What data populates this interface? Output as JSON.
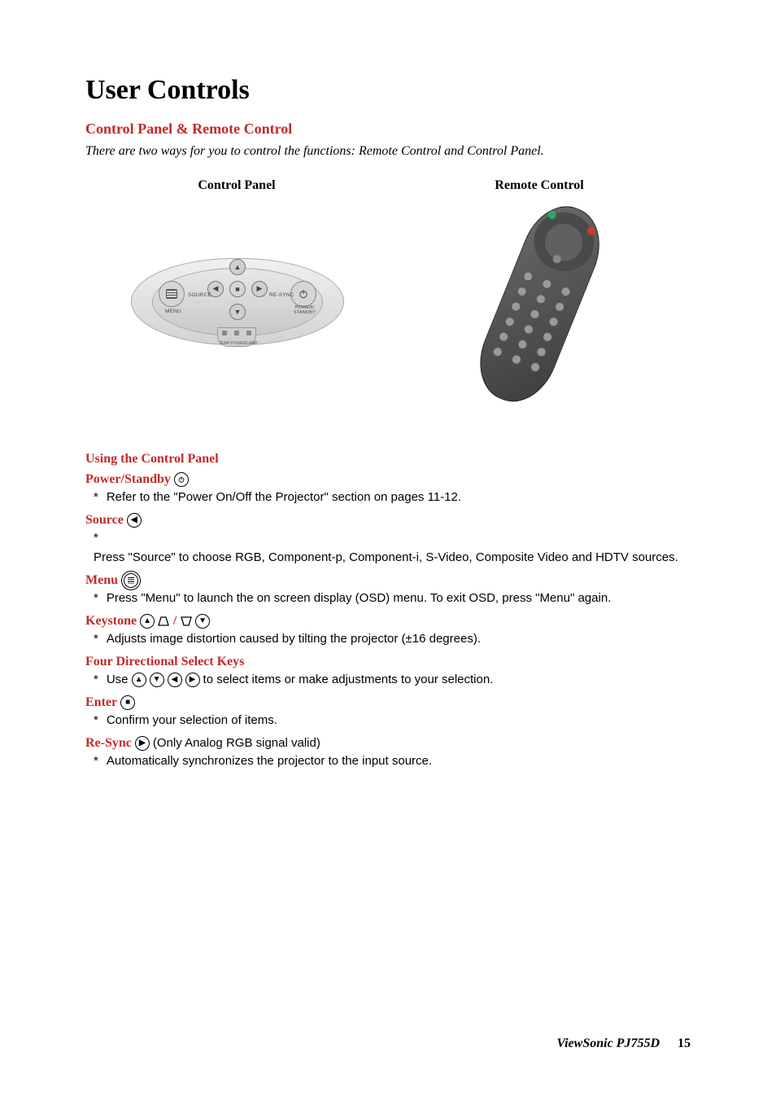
{
  "title": "User Controls",
  "section": "Control Panel & Remote Control",
  "intro": "There are two ways for you to control the functions: Remote Control and Control Panel.",
  "col_headers": {
    "left": "Control Panel",
    "right": "Remote Control"
  },
  "cp_labels": {
    "menu": "MENU",
    "source": "SOURCE",
    "resync": "RE-SYNC",
    "power1": "POWER/",
    "power2": "STANDBY",
    "led_a": "TEMP",
    "led_b": "POWER",
    "led_c": "LAMP"
  },
  "using_heading": "Using the Control Panel",
  "items": {
    "power": {
      "label": "Power/Standby",
      "bullet": "Refer to the \"Power On/Off the Projector\" section on pages 11-12."
    },
    "source": {
      "label": "Source",
      "bullet": "Press \"Source\" to choose RGB, Component-p, Component-i, S-Video, Composite Video and HDTV sources."
    },
    "menu": {
      "label": "Menu",
      "bullet": "Press \"Menu\" to launch the on screen display (OSD) menu. To exit OSD, press \"Menu\" again."
    },
    "keystone": {
      "label": "Keystone",
      "bullet": "Adjusts image distortion caused by tilting the projector (±16 degrees)."
    },
    "fourdir": {
      "label": "Four Directional Select Keys",
      "bullet_pre": "Use",
      "bullet_post": "to select items or make adjustments to your selection."
    },
    "enter": {
      "label": "Enter",
      "bullet": "Confirm your selection of items."
    },
    "resync": {
      "label": "Re-Sync",
      "note": "(Only Analog RGB signal valid)",
      "bullet": "Automatically synchronizes the projector to the input source."
    }
  },
  "separator": "/",
  "footer": {
    "model": "ViewSonic PJ755D",
    "page": "15"
  }
}
